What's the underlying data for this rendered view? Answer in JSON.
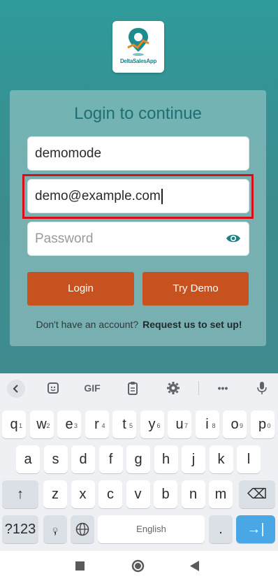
{
  "app": {
    "logo_text": "DeltaSalesApp",
    "card_title": "Login to continue",
    "company_field": {
      "value": "demomode"
    },
    "email_field": {
      "value": "demo@example.com"
    },
    "password_field": {
      "placeholder": "Password"
    },
    "login_label": "Login",
    "try_demo_label": "Try Demo",
    "signup_question": "Don't have an account?",
    "signup_link": "Request us to set up!"
  },
  "colors": {
    "accent": "#c8521f",
    "teal": "#1f7f86",
    "highlight": "#d6101a"
  },
  "keyboard": {
    "toolbar": [
      "back-icon",
      "sticker-icon",
      "GIF",
      "clipboard-icon",
      "settings-icon",
      "more-icon",
      "mic-icon"
    ],
    "gif_label": "GIF",
    "more_label": "•••",
    "rows": [
      [
        {
          "k": "q",
          "s": "1"
        },
        {
          "k": "w",
          "s": "2"
        },
        {
          "k": "e",
          "s": "3"
        },
        {
          "k": "r",
          "s": "4"
        },
        {
          "k": "t",
          "s": "5"
        },
        {
          "k": "y",
          "s": "6"
        },
        {
          "k": "u",
          "s": "7"
        },
        {
          "k": "i",
          "s": "8"
        },
        {
          "k": "o",
          "s": "9"
        },
        {
          "k": "p",
          "s": "0"
        }
      ],
      [
        {
          "k": "a"
        },
        {
          "k": "s"
        },
        {
          "k": "d"
        },
        {
          "k": "f"
        },
        {
          "k": "g"
        },
        {
          "k": "h"
        },
        {
          "k": "j"
        },
        {
          "k": "k"
        },
        {
          "k": "l"
        }
      ],
      [
        {
          "k": "z"
        },
        {
          "k": "x"
        },
        {
          "k": "c"
        },
        {
          "k": "v"
        },
        {
          "k": "b"
        },
        {
          "k": "n"
        },
        {
          "k": "m"
        }
      ]
    ],
    "shift_label": "↑",
    "backspace_label": "⌫",
    "symbols_label": "?123",
    "emoji_label": "☺",
    "comma_label": ",",
    "space_label": "English",
    "period_label": ".",
    "enter_label": "→|"
  },
  "navbar": {
    "back": "back-triangle-icon",
    "home": "home-circle-icon",
    "recents": "recents-square-icon"
  }
}
